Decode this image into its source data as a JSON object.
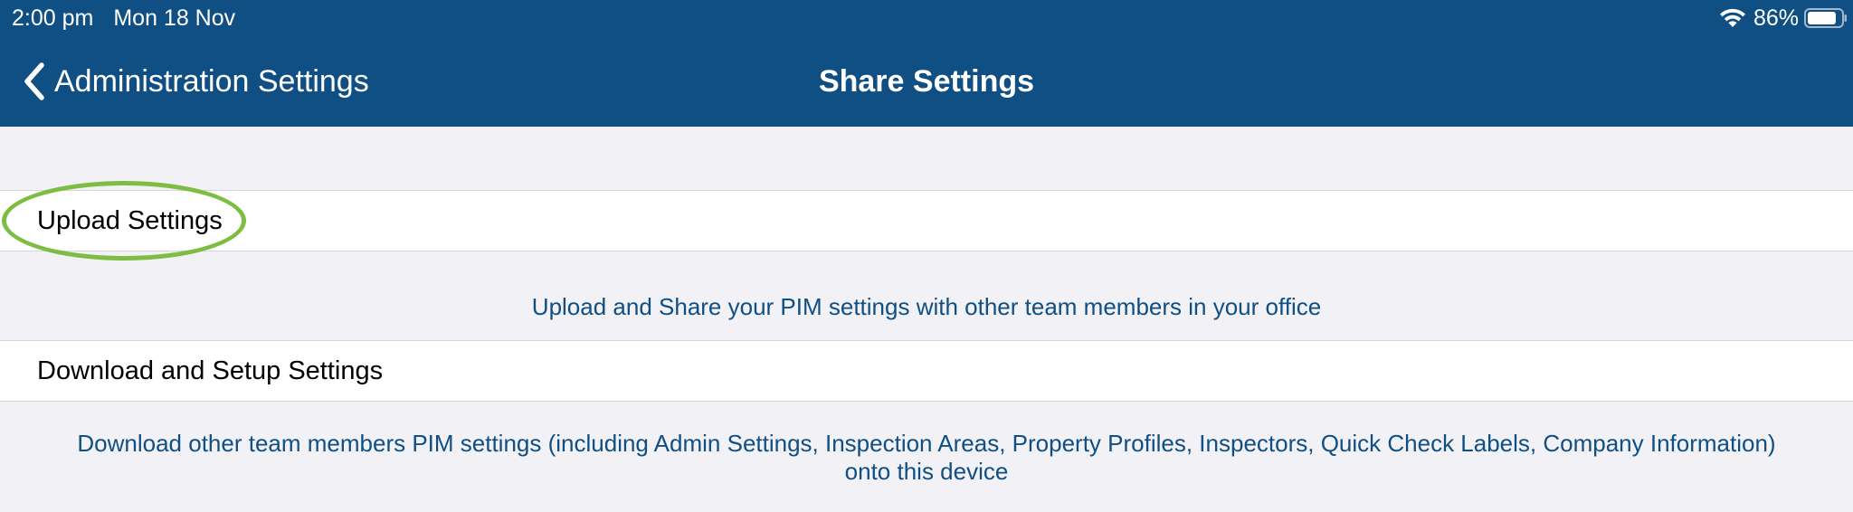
{
  "status_bar": {
    "time": "2:00 pm",
    "date": "Mon 18 Nov",
    "battery_percent": "86%",
    "battery_level": 0.86,
    "wifi_icon": "wifi-icon",
    "battery_icon": "battery-icon"
  },
  "nav": {
    "back_label": "Administration Settings",
    "back_icon": "chevron-left-icon",
    "title": "Share Settings"
  },
  "rows": {
    "upload": {
      "label": "Upload Settings",
      "description": "Upload and Share your PIM settings with other team members in your office"
    },
    "download": {
      "label": "Download and Setup Settings",
      "description": "Download other team members PIM settings (including Admin Settings, Inspection Areas, Property Profiles, Inspectors, Quick Check Labels, Company Information) onto this device"
    }
  },
  "colors": {
    "header_bg": "#104f83",
    "page_bg": "#f1f1f6",
    "description_text": "#104f83",
    "highlight_ring": "#7cbd42"
  }
}
